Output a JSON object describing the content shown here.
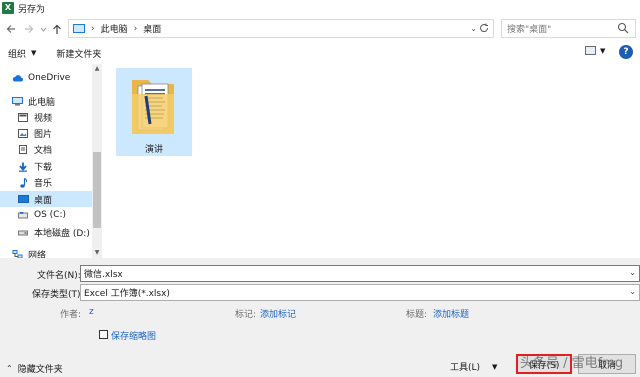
{
  "window": {
    "title": "另存为",
    "app_icon": "X"
  },
  "address_bar": {
    "breadcrumbs": [
      "此电脑",
      "桌面"
    ]
  },
  "search": {
    "placeholder": "搜索\"桌面\""
  },
  "toolbar": {
    "organize_label": "组织",
    "new_folder_label": "新建文件夹"
  },
  "nav_pane": {
    "items": [
      {
        "label": "OneDrive",
        "icon": "cloud-icon"
      },
      {
        "label": "此电脑",
        "icon": "computer-icon"
      },
      {
        "label": "视频",
        "icon": "video-icon"
      },
      {
        "label": "图片",
        "icon": "pictures-icon"
      },
      {
        "label": "文档",
        "icon": "documents-icon"
      },
      {
        "label": "下载",
        "icon": "download-icon"
      },
      {
        "label": "音乐",
        "icon": "music-icon"
      },
      {
        "label": "桌面",
        "icon": "desktop-icon",
        "selected": true
      },
      {
        "label": "OS (C:)",
        "icon": "drive-icon"
      },
      {
        "label": "本地磁盘 (D:)",
        "icon": "disk-icon"
      },
      {
        "label": "网络",
        "icon": "network-icon"
      }
    ]
  },
  "files": [
    {
      "name": "演讲",
      "icon": "folder-icon",
      "selected": true
    }
  ],
  "form": {
    "filename_label": "文件名(N):",
    "filename_value": "微信.xlsx",
    "filetype_label": "保存类型(T):",
    "filetype_value": "Excel 工作簿(*.xlsx)",
    "author_label": "作者:",
    "author_value": "z",
    "tags_label": "标记:",
    "tags_link": "添加标记",
    "title_label": "标题:",
    "title_link": "添加标题",
    "thumbnail_label": "保存缩略图"
  },
  "footer": {
    "hide_folders_label": "隐藏文件夹",
    "tools_label": "工具(L)",
    "save_label": "保存(S)",
    "cancel_label": "取消"
  },
  "watermark": "头条号 / 雷电fmg",
  "colors": {
    "accent": "#1a63c8",
    "selection": "#cce8ff",
    "highlight": "#e02020",
    "excel_green": "#1f7a45"
  }
}
